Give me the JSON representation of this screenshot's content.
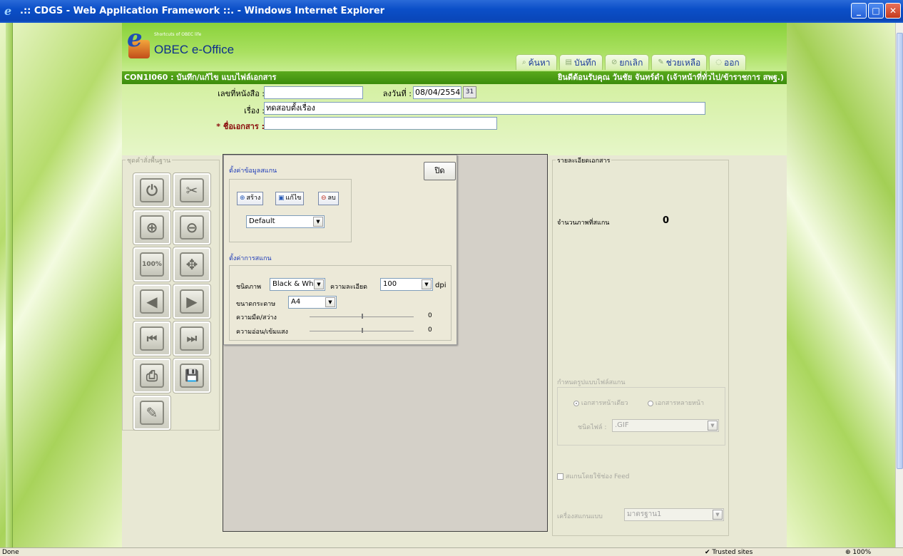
{
  "window": {
    "title": ".:: CDGS - Web Application Framework ::. - Windows Internet Explorer",
    "controls": [
      "minimize",
      "maximize",
      "close"
    ]
  },
  "app": {
    "logo_small": "Shortcuts of OBEC life",
    "logo_title": "OBEC e-Office",
    "nav": [
      {
        "label": "ค้นหา",
        "icon": "search-icon"
      },
      {
        "label": "บันทึก",
        "icon": "save-icon"
      },
      {
        "label": "ยกเลิก",
        "icon": "cancel-icon"
      },
      {
        "label": "ช่วยเหลือ",
        "icon": "help-icon"
      },
      {
        "label": "ออก",
        "icon": "exit-icon"
      }
    ],
    "module_title": "CON1I060 : บันทึก/แก้ไข แบบไฟล์เอกสาร",
    "welcome": "ยินดีต้อนรับคุณ วันชัย จันทร์ดำ (เจ้าหน้าที่ทั่วไป/ข้าราชการ สพฐ.)"
  },
  "form": {
    "doc_no_label": "เลขที่หนังสือ :",
    "doc_no_value": "",
    "date_label": "ลงวันที่ :",
    "date_value": "08/04/2554",
    "calendar_label": "31",
    "subject_label": "เรื่อง :",
    "subject_value": "ทดสอบตั้งเรื่อง",
    "docname_label": "* ชื่อเอกสาร :",
    "docname_value": ""
  },
  "toolbox": {
    "legend": "ชุดคำสั่งพื้นฐาน",
    "tools": [
      {
        "name": "power-icon",
        "glyph": "⏻"
      },
      {
        "name": "tools-icon",
        "glyph": "✂"
      },
      {
        "name": "zoom-in-icon",
        "glyph": "⊕"
      },
      {
        "name": "zoom-out-icon",
        "glyph": "⊖"
      },
      {
        "name": "actual-size-icon",
        "glyph": "100%"
      },
      {
        "name": "fit-page-icon",
        "glyph": "✥"
      },
      {
        "name": "previous-icon",
        "glyph": "◀"
      },
      {
        "name": "next-icon",
        "glyph": "▶"
      },
      {
        "name": "first-page-icon",
        "glyph": "⏮"
      },
      {
        "name": "last-page-icon",
        "glyph": "⏭"
      },
      {
        "name": "print-icon",
        "glyph": "⎙"
      },
      {
        "name": "save-disk-icon",
        "glyph": "💾"
      },
      {
        "name": "edit-pencil-icon",
        "glyph": "✎"
      }
    ]
  },
  "scan_panel": {
    "close_label": "ปิด",
    "profile_title": "ตั้งค่าข้อมูลสแกน",
    "btn_create": "สร้าง",
    "btn_edit": "แก้ไข",
    "btn_delete": "ลบ",
    "profile_value": "Default",
    "settings_title": "ตั้งค่าการสแกน",
    "image_type_label": "ชนิดภาพ",
    "image_type_value": "Black & Whi",
    "resolution_label": "ความละเอียด",
    "resolution_value": "100",
    "dpi_label": "dpi",
    "paper_label": "ขนาดกระดาษ",
    "paper_value": "A4",
    "brightness_label": "ความมืด/สว่าง",
    "brightness_value": "0",
    "contrast_label": "ความอ่อน/เข้มแสง",
    "contrast_value": "0"
  },
  "detail": {
    "legend": "รายละเอียดเอกสาร",
    "scanned_label": "จำนวนภาพที่สแกน",
    "scanned_value": "0",
    "format_label": "กำหนดรูปแบบไฟล์สแกน",
    "single_page": "เอกสารหน้าเดียว",
    "multi_page": "เอกสารหลายหน้า",
    "filetype_label": "ชนิดไฟล์ :",
    "filetype_value": ".GIF",
    "feed_label": "สแกนโดยใช้ช่อง Feed",
    "scanner_label": "เครื่องสแกนแบบ",
    "scanner_value": "มาตรฐาน1"
  },
  "status": {
    "left": "Done",
    "zone": "Trusted sites",
    "zoom": "100%"
  }
}
